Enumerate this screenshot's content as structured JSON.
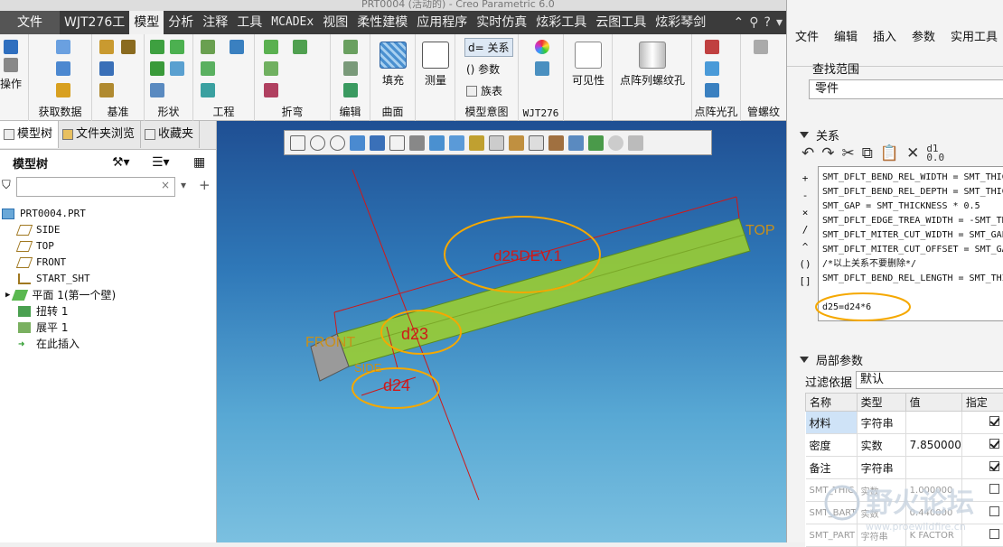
{
  "title_text": "PRT0004 (活动的) - Creo Parametric 6.0",
  "tabs": [
    "文件",
    "WJT276工",
    "模型",
    "分析",
    "注释",
    "工具",
    "MCADEx",
    "视图",
    "柔性建模",
    "应用程序",
    "实时仿真",
    "炫彩工具",
    "云图工具",
    "炫彩琴剑"
  ],
  "ribbon": {
    "operate_label": "操作",
    "groups": [
      "获取数据",
      "基准",
      "形状",
      "工程",
      "折弯",
      "编辑",
      "曲面",
      "模型意图",
      "WJT276",
      "点阵光孔",
      "管螺纹"
    ],
    "fill_label": "填充",
    "measure_label": "测量",
    "relations_label": "d= 关系",
    "params_label": "() 参数",
    "family_label": "族表",
    "visibility_label": "可见性",
    "thread_label": "点阵列螺纹孔"
  },
  "left_panel": {
    "tabs": [
      "模型树",
      "文件夹浏览",
      "收藏夹"
    ],
    "heading": "模型树",
    "search_placeholder": "",
    "items": [
      {
        "label": "PRT0004.PRT",
        "icon": "part-icon"
      },
      {
        "label": "SIDE",
        "icon": "datum-plane-icon"
      },
      {
        "label": "TOP",
        "icon": "datum-plane-icon"
      },
      {
        "label": "FRONT",
        "icon": "datum-plane-icon"
      },
      {
        "label": "START_SHT",
        "icon": "coordinate-system-icon"
      },
      {
        "label": "平面 1(第一个壁)",
        "icon": "flat-wall-icon"
      },
      {
        "label": "扭转 1",
        "icon": "twist-icon"
      },
      {
        "label": "展平 1",
        "icon": "unbend-icon"
      },
      {
        "label": "在此插入",
        "icon": "insert-here-icon"
      }
    ]
  },
  "viewport": {
    "labels": {
      "top": "TOP",
      "front": "FRONT",
      "side": "SIDE",
      "d25": "d25DEV.1",
      "d23": "d23",
      "d24": "d24"
    }
  },
  "right_panel": {
    "menu": [
      "文件",
      "编辑",
      "插入",
      "参数",
      "实用工具"
    ],
    "search_scope_label": "查找范围",
    "search_scope_value": "零件",
    "relations_title": "关系",
    "operators": [
      "+",
      "-",
      "×",
      "/",
      "^",
      "()",
      "[]"
    ],
    "relation_lines": [
      "SMT_DFLT_BEND_REL_WIDTH = SMT_THICKNESS",
      "SMT_DFLT_BEND_REL_DEPTH = SMT_THICKNESS",
      "SMT_GAP = SMT_THICKNESS  * 0.5",
      "SMT_DFLT_EDGE_TREA_WIDTH = -SMT_THICKNESS",
      "SMT_DFLT_MITER_CUT_WIDTH = SMT_GAP",
      "SMT_DFLT_MITER_CUT_OFFSET = SMT_GAP",
      "/*以上关系不要删除*/",
      "SMT_DFLT_BEND_REL_LENGTH = SMT_THICKNESS",
      "",
      "d25=d24*6"
    ],
    "local_params_title": "局部参数",
    "filter_label": "过滤依据",
    "filter_value": "默认",
    "table_headers": [
      "名称",
      "类型",
      "值",
      "指定"
    ],
    "rows": [
      {
        "name": "材料",
        "type": "字符串",
        "value": "",
        "checked": true
      },
      {
        "name": "密度",
        "type": "实数",
        "value": "7.850000",
        "checked": true
      },
      {
        "name": "备注",
        "type": "字符串",
        "value": "",
        "checked": true
      },
      {
        "name": "SMT_THIC",
        "type": "实数",
        "value": "1.000000",
        "checked": false
      },
      {
        "name": "SMT_BART",
        "type": "实数",
        "value": "0.440000",
        "checked": false
      },
      {
        "name": "SMT_PART",
        "type": "字符串",
        "value": "K FACTOR",
        "checked": false
      }
    ]
  },
  "watermark": {
    "text": "野火论坛",
    "url": "www.proewildfire.cn"
  },
  "colors": {
    "accent": "#f5a800",
    "dim_red": "#d01818",
    "plate_green": "#9acd32",
    "viewport_top": "#1f4f93"
  }
}
